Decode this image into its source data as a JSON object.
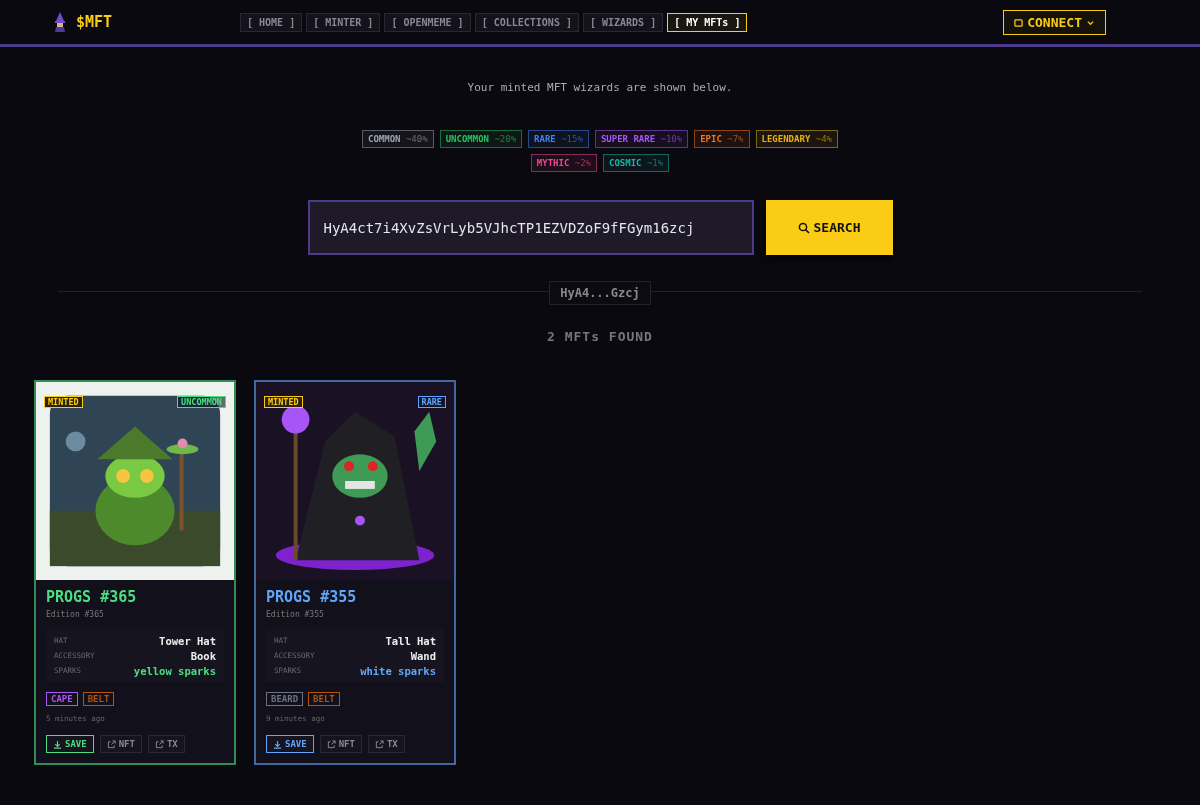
{
  "header": {
    "logo": "$MFT",
    "nav": [
      {
        "label": "[ HOME ]",
        "selected": false
      },
      {
        "label": "[ MINTER ]",
        "selected": false
      },
      {
        "label": "[ OPENMEME ]",
        "selected": false
      },
      {
        "label": "[ COLLECTIONS ]",
        "selected": false
      },
      {
        "label": "[ WIZARDS ]",
        "selected": false
      },
      {
        "label": "[ MY MFTs ]",
        "selected": true
      }
    ],
    "connect": "CONNECT"
  },
  "subtitle": "Your minted MFT wizards are shown below.",
  "rarities": [
    {
      "name": "COMMON",
      "odds": "~40%",
      "color": "#9ca3af"
    },
    {
      "name": "UNCOMMON",
      "odds": "~20%",
      "color": "#22c55e"
    },
    {
      "name": "RARE",
      "odds": "~15%",
      "color": "#3b82f6"
    },
    {
      "name": "SUPER RARE",
      "odds": "~10%",
      "color": "#a855f7"
    },
    {
      "name": "EPIC",
      "odds": "~7%",
      "color": "#f97316"
    },
    {
      "name": "LEGENDARY",
      "odds": "~4%",
      "color": "#eab308"
    },
    {
      "name": "MYTHIC",
      "odds": "~2%",
      "color": "#ec4899"
    },
    {
      "name": "COSMIC",
      "odds": "~1%",
      "color": "#14b8a6"
    }
  ],
  "search": {
    "value": "HyA4ct7i4XvZsVrLyb5VJhcTP1EZVDZoF9fFGym16zcj",
    "button": "SEARCH"
  },
  "wallet_label": "HyA4...Gzcj",
  "found": "2 MFTs FOUND",
  "cards": [
    {
      "status": "MINTED",
      "rarity": "UNCOMMON",
      "color": "#4ade80",
      "title": "PROGS #365",
      "edition": "Edition #365",
      "traits": [
        {
          "key": "HAT",
          "value": "Tower Hat",
          "accent": false
        },
        {
          "key": "ACCESSORY",
          "value": "Book",
          "accent": false
        },
        {
          "key": "SPARKS",
          "value": "yellow sparks",
          "accent": true
        }
      ],
      "tags": [
        {
          "label": "CAPE",
          "color": "#a855f7"
        },
        {
          "label": "BELT",
          "color": "#b45309"
        }
      ],
      "time": "5 minutes ago",
      "buttons": [
        "SAVE",
        "NFT",
        "TX"
      ]
    },
    {
      "status": "MINTED",
      "rarity": "RARE",
      "color": "#60a5fa",
      "title": "PROGS #355",
      "edition": "Edition #355",
      "traits": [
        {
          "key": "HAT",
          "value": "Tall Hat",
          "accent": false
        },
        {
          "key": "ACCESSORY",
          "value": "Wand",
          "accent": false
        },
        {
          "key": "SPARKS",
          "value": "white sparks",
          "accent": true
        }
      ],
      "tags": [
        {
          "label": "BEARD",
          "color": "#6b7280"
        },
        {
          "label": "BELT",
          "color": "#b45309"
        }
      ],
      "time": "9 minutes ago",
      "buttons": [
        "SAVE",
        "NFT",
        "TX"
      ]
    }
  ]
}
